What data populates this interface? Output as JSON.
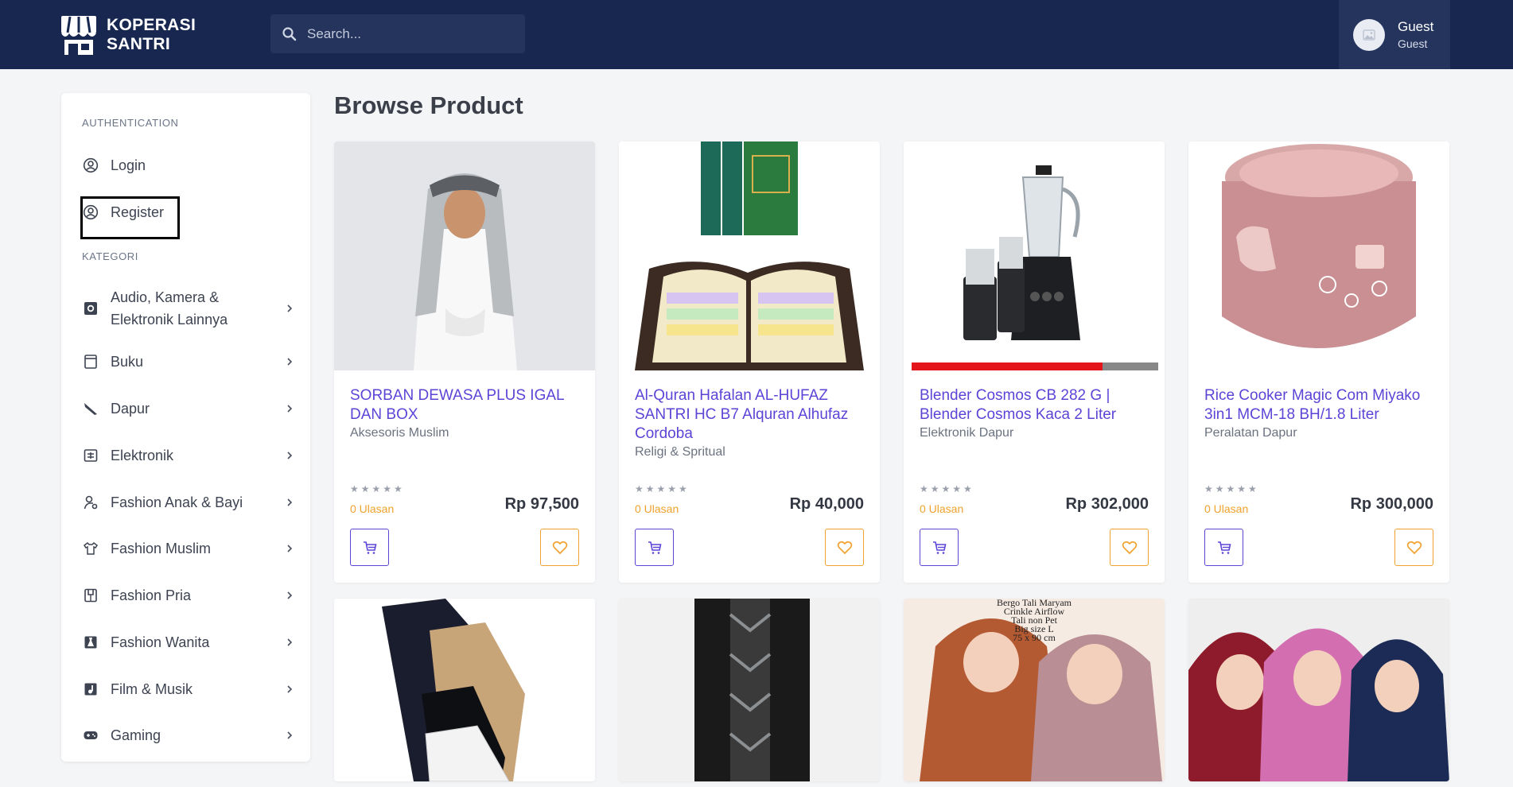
{
  "header": {
    "brand_line1": "KOPERASI",
    "brand_line2": "SANTRI",
    "search_placeholder": "Search...",
    "user_name": "Guest",
    "user_role": "Guest"
  },
  "sidebar": {
    "auth_title": "AUTHENTICATION",
    "auth_items": [
      {
        "label": "Login",
        "icon": "user-circle-icon"
      },
      {
        "label": "Register",
        "icon": "user-circle-icon"
      }
    ],
    "category_title": "KATEGORI",
    "categories": [
      {
        "label_line1": "Audio, Kamera &",
        "label_line2": "Elektronik Lainnya",
        "icon": "camera-icon"
      },
      {
        "label": "Buku",
        "icon": "book-icon"
      },
      {
        "label": "Dapur",
        "icon": "knife-icon"
      },
      {
        "label": "Elektronik",
        "icon": "plug-icon"
      },
      {
        "label": "Fashion Anak & Bayi",
        "icon": "baby-icon"
      },
      {
        "label": "Fashion Muslim",
        "icon": "shirt-icon"
      },
      {
        "label": "Fashion Pria",
        "icon": "shirt-tag-icon"
      },
      {
        "label": "Fashion Wanita",
        "icon": "dress-icon"
      },
      {
        "label": "Film & Musik",
        "icon": "music-note-icon"
      },
      {
        "label": "Gaming",
        "icon": "gamepad-icon"
      }
    ]
  },
  "main": {
    "title": "Browse Product",
    "products": [
      {
        "name": "SORBAN DEWASA PLUS IGAL DAN BOX",
        "category": "Aksesoris Muslim",
        "reviews": "0 Ulasan",
        "price": "Rp 97,500",
        "rating": 0,
        "max_rating": 5
      },
      {
        "name": "Al-Quran Hafalan AL-HUFAZ SANTRI HC B7 Alquran Alhufaz Cordoba",
        "category": "Religi & Spritual",
        "reviews": "0 Ulasan",
        "price": "Rp 40,000",
        "rating": 0,
        "max_rating": 5
      },
      {
        "name": "Blender Cosmos CB 282 G | Blender Cosmos Kaca 2 Liter",
        "category": "Elektronik Dapur",
        "reviews": "0 Ulasan",
        "price": "Rp 302,000",
        "rating": 0,
        "max_rating": 5
      },
      {
        "name": "Rice Cooker Magic Com Miyako 3in1 MCM-18 BH/1.8 Liter",
        "category": "Peralatan Dapur",
        "reviews": "0 Ulasan",
        "price": "Rp 300,000",
        "rating": 0,
        "max_rating": 5
      }
    ],
    "image_caption_4": [
      "Bergo Tali Maryam",
      "Crinkle Airflow",
      "Tali non Pet",
      "Big size L",
      "75 x 90 cm"
    ]
  },
  "colors": {
    "navbar": "#172750",
    "accent_purple": "#5b45d6",
    "accent_orange": "#f0a22e"
  }
}
